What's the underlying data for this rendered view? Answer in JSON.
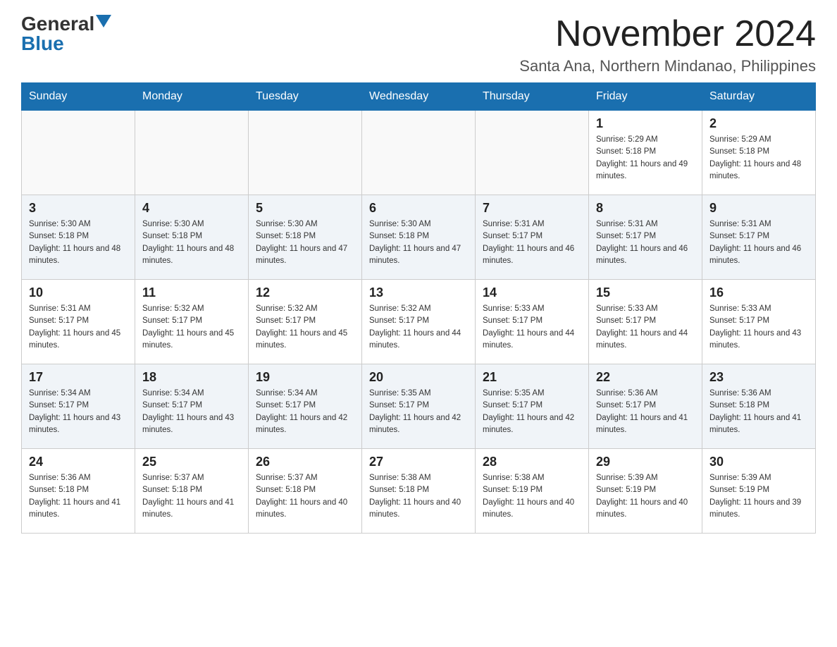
{
  "header": {
    "logo_general": "General",
    "logo_blue": "Blue",
    "month_title": "November 2024",
    "subtitle": "Santa Ana, Northern Mindanao, Philippines"
  },
  "days_of_week": [
    "Sunday",
    "Monday",
    "Tuesday",
    "Wednesday",
    "Thursday",
    "Friday",
    "Saturday"
  ],
  "weeks": [
    {
      "days": [
        {
          "number": "",
          "info": ""
        },
        {
          "number": "",
          "info": ""
        },
        {
          "number": "",
          "info": ""
        },
        {
          "number": "",
          "info": ""
        },
        {
          "number": "",
          "info": ""
        },
        {
          "number": "1",
          "info": "Sunrise: 5:29 AM\nSunset: 5:18 PM\nDaylight: 11 hours and 49 minutes."
        },
        {
          "number": "2",
          "info": "Sunrise: 5:29 AM\nSunset: 5:18 PM\nDaylight: 11 hours and 48 minutes."
        }
      ]
    },
    {
      "days": [
        {
          "number": "3",
          "info": "Sunrise: 5:30 AM\nSunset: 5:18 PM\nDaylight: 11 hours and 48 minutes."
        },
        {
          "number": "4",
          "info": "Sunrise: 5:30 AM\nSunset: 5:18 PM\nDaylight: 11 hours and 48 minutes."
        },
        {
          "number": "5",
          "info": "Sunrise: 5:30 AM\nSunset: 5:18 PM\nDaylight: 11 hours and 47 minutes."
        },
        {
          "number": "6",
          "info": "Sunrise: 5:30 AM\nSunset: 5:18 PM\nDaylight: 11 hours and 47 minutes."
        },
        {
          "number": "7",
          "info": "Sunrise: 5:31 AM\nSunset: 5:17 PM\nDaylight: 11 hours and 46 minutes."
        },
        {
          "number": "8",
          "info": "Sunrise: 5:31 AM\nSunset: 5:17 PM\nDaylight: 11 hours and 46 minutes."
        },
        {
          "number": "9",
          "info": "Sunrise: 5:31 AM\nSunset: 5:17 PM\nDaylight: 11 hours and 46 minutes."
        }
      ]
    },
    {
      "days": [
        {
          "number": "10",
          "info": "Sunrise: 5:31 AM\nSunset: 5:17 PM\nDaylight: 11 hours and 45 minutes."
        },
        {
          "number": "11",
          "info": "Sunrise: 5:32 AM\nSunset: 5:17 PM\nDaylight: 11 hours and 45 minutes."
        },
        {
          "number": "12",
          "info": "Sunrise: 5:32 AM\nSunset: 5:17 PM\nDaylight: 11 hours and 45 minutes."
        },
        {
          "number": "13",
          "info": "Sunrise: 5:32 AM\nSunset: 5:17 PM\nDaylight: 11 hours and 44 minutes."
        },
        {
          "number": "14",
          "info": "Sunrise: 5:33 AM\nSunset: 5:17 PM\nDaylight: 11 hours and 44 minutes."
        },
        {
          "number": "15",
          "info": "Sunrise: 5:33 AM\nSunset: 5:17 PM\nDaylight: 11 hours and 44 minutes."
        },
        {
          "number": "16",
          "info": "Sunrise: 5:33 AM\nSunset: 5:17 PM\nDaylight: 11 hours and 43 minutes."
        }
      ]
    },
    {
      "days": [
        {
          "number": "17",
          "info": "Sunrise: 5:34 AM\nSunset: 5:17 PM\nDaylight: 11 hours and 43 minutes."
        },
        {
          "number": "18",
          "info": "Sunrise: 5:34 AM\nSunset: 5:17 PM\nDaylight: 11 hours and 43 minutes."
        },
        {
          "number": "19",
          "info": "Sunrise: 5:34 AM\nSunset: 5:17 PM\nDaylight: 11 hours and 42 minutes."
        },
        {
          "number": "20",
          "info": "Sunrise: 5:35 AM\nSunset: 5:17 PM\nDaylight: 11 hours and 42 minutes."
        },
        {
          "number": "21",
          "info": "Sunrise: 5:35 AM\nSunset: 5:17 PM\nDaylight: 11 hours and 42 minutes."
        },
        {
          "number": "22",
          "info": "Sunrise: 5:36 AM\nSunset: 5:17 PM\nDaylight: 11 hours and 41 minutes."
        },
        {
          "number": "23",
          "info": "Sunrise: 5:36 AM\nSunset: 5:18 PM\nDaylight: 11 hours and 41 minutes."
        }
      ]
    },
    {
      "days": [
        {
          "number": "24",
          "info": "Sunrise: 5:36 AM\nSunset: 5:18 PM\nDaylight: 11 hours and 41 minutes."
        },
        {
          "number": "25",
          "info": "Sunrise: 5:37 AM\nSunset: 5:18 PM\nDaylight: 11 hours and 41 minutes."
        },
        {
          "number": "26",
          "info": "Sunrise: 5:37 AM\nSunset: 5:18 PM\nDaylight: 11 hours and 40 minutes."
        },
        {
          "number": "27",
          "info": "Sunrise: 5:38 AM\nSunset: 5:18 PM\nDaylight: 11 hours and 40 minutes."
        },
        {
          "number": "28",
          "info": "Sunrise: 5:38 AM\nSunset: 5:19 PM\nDaylight: 11 hours and 40 minutes."
        },
        {
          "number": "29",
          "info": "Sunrise: 5:39 AM\nSunset: 5:19 PM\nDaylight: 11 hours and 40 minutes."
        },
        {
          "number": "30",
          "info": "Sunrise: 5:39 AM\nSunset: 5:19 PM\nDaylight: 11 hours and 39 minutes."
        }
      ]
    }
  ]
}
